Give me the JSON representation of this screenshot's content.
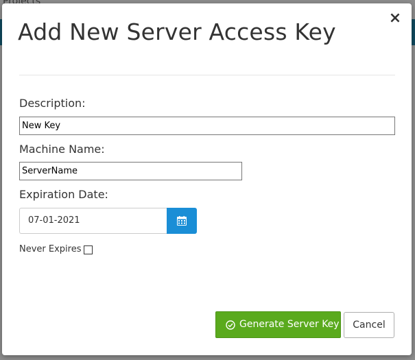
{
  "background": {
    "page_title": "Projects"
  },
  "modal": {
    "title": "Add New Server Access Key",
    "close_symbol": "×"
  },
  "form": {
    "description_label": "Description:",
    "description_value": "New Key",
    "machine_name_label": "Machine Name:",
    "machine_name_value": "ServerName",
    "expiration_label": "Expiration Date:",
    "expiration_value": "07-01-2021",
    "never_expires_label": "Never Expires",
    "never_expires_checked": false
  },
  "actions": {
    "generate_label": "Generate Server Key",
    "cancel_label": "Cancel"
  },
  "icons": {
    "calendar": "calendar-icon",
    "check_circle": "check-circle-icon",
    "close": "close-icon"
  },
  "colors": {
    "primary_blue": "#1a8ed6",
    "success_green": "#5aaa1d",
    "header_bar": "#0f4a5e"
  }
}
